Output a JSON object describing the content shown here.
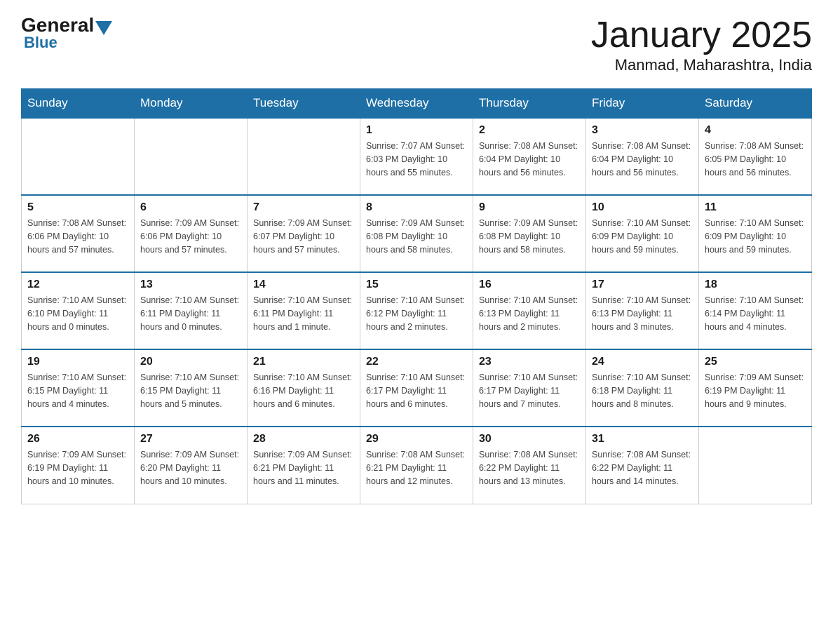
{
  "header": {
    "logo": {
      "general": "General",
      "blue": "Blue"
    },
    "title": "January 2025",
    "location": "Manmad, Maharashtra, India"
  },
  "days": [
    "Sunday",
    "Monday",
    "Tuesday",
    "Wednesday",
    "Thursday",
    "Friday",
    "Saturday"
  ],
  "weeks": [
    [
      {
        "day": "",
        "info": ""
      },
      {
        "day": "",
        "info": ""
      },
      {
        "day": "",
        "info": ""
      },
      {
        "day": "1",
        "info": "Sunrise: 7:07 AM\nSunset: 6:03 PM\nDaylight: 10 hours\nand 55 minutes."
      },
      {
        "day": "2",
        "info": "Sunrise: 7:08 AM\nSunset: 6:04 PM\nDaylight: 10 hours\nand 56 minutes."
      },
      {
        "day": "3",
        "info": "Sunrise: 7:08 AM\nSunset: 6:04 PM\nDaylight: 10 hours\nand 56 minutes."
      },
      {
        "day": "4",
        "info": "Sunrise: 7:08 AM\nSunset: 6:05 PM\nDaylight: 10 hours\nand 56 minutes."
      }
    ],
    [
      {
        "day": "5",
        "info": "Sunrise: 7:08 AM\nSunset: 6:06 PM\nDaylight: 10 hours\nand 57 minutes."
      },
      {
        "day": "6",
        "info": "Sunrise: 7:09 AM\nSunset: 6:06 PM\nDaylight: 10 hours\nand 57 minutes."
      },
      {
        "day": "7",
        "info": "Sunrise: 7:09 AM\nSunset: 6:07 PM\nDaylight: 10 hours\nand 57 minutes."
      },
      {
        "day": "8",
        "info": "Sunrise: 7:09 AM\nSunset: 6:08 PM\nDaylight: 10 hours\nand 58 minutes."
      },
      {
        "day": "9",
        "info": "Sunrise: 7:09 AM\nSunset: 6:08 PM\nDaylight: 10 hours\nand 58 minutes."
      },
      {
        "day": "10",
        "info": "Sunrise: 7:10 AM\nSunset: 6:09 PM\nDaylight: 10 hours\nand 59 minutes."
      },
      {
        "day": "11",
        "info": "Sunrise: 7:10 AM\nSunset: 6:09 PM\nDaylight: 10 hours\nand 59 minutes."
      }
    ],
    [
      {
        "day": "12",
        "info": "Sunrise: 7:10 AM\nSunset: 6:10 PM\nDaylight: 11 hours\nand 0 minutes."
      },
      {
        "day": "13",
        "info": "Sunrise: 7:10 AM\nSunset: 6:11 PM\nDaylight: 11 hours\nand 0 minutes."
      },
      {
        "day": "14",
        "info": "Sunrise: 7:10 AM\nSunset: 6:11 PM\nDaylight: 11 hours\nand 1 minute."
      },
      {
        "day": "15",
        "info": "Sunrise: 7:10 AM\nSunset: 6:12 PM\nDaylight: 11 hours\nand 2 minutes."
      },
      {
        "day": "16",
        "info": "Sunrise: 7:10 AM\nSunset: 6:13 PM\nDaylight: 11 hours\nand 2 minutes."
      },
      {
        "day": "17",
        "info": "Sunrise: 7:10 AM\nSunset: 6:13 PM\nDaylight: 11 hours\nand 3 minutes."
      },
      {
        "day": "18",
        "info": "Sunrise: 7:10 AM\nSunset: 6:14 PM\nDaylight: 11 hours\nand 4 minutes."
      }
    ],
    [
      {
        "day": "19",
        "info": "Sunrise: 7:10 AM\nSunset: 6:15 PM\nDaylight: 11 hours\nand 4 minutes."
      },
      {
        "day": "20",
        "info": "Sunrise: 7:10 AM\nSunset: 6:15 PM\nDaylight: 11 hours\nand 5 minutes."
      },
      {
        "day": "21",
        "info": "Sunrise: 7:10 AM\nSunset: 6:16 PM\nDaylight: 11 hours\nand 6 minutes."
      },
      {
        "day": "22",
        "info": "Sunrise: 7:10 AM\nSunset: 6:17 PM\nDaylight: 11 hours\nand 6 minutes."
      },
      {
        "day": "23",
        "info": "Sunrise: 7:10 AM\nSunset: 6:17 PM\nDaylight: 11 hours\nand 7 minutes."
      },
      {
        "day": "24",
        "info": "Sunrise: 7:10 AM\nSunset: 6:18 PM\nDaylight: 11 hours\nand 8 minutes."
      },
      {
        "day": "25",
        "info": "Sunrise: 7:09 AM\nSunset: 6:19 PM\nDaylight: 11 hours\nand 9 minutes."
      }
    ],
    [
      {
        "day": "26",
        "info": "Sunrise: 7:09 AM\nSunset: 6:19 PM\nDaylight: 11 hours\nand 10 minutes."
      },
      {
        "day": "27",
        "info": "Sunrise: 7:09 AM\nSunset: 6:20 PM\nDaylight: 11 hours\nand 10 minutes."
      },
      {
        "day": "28",
        "info": "Sunrise: 7:09 AM\nSunset: 6:21 PM\nDaylight: 11 hours\nand 11 minutes."
      },
      {
        "day": "29",
        "info": "Sunrise: 7:08 AM\nSunset: 6:21 PM\nDaylight: 11 hours\nand 12 minutes."
      },
      {
        "day": "30",
        "info": "Sunrise: 7:08 AM\nSunset: 6:22 PM\nDaylight: 11 hours\nand 13 minutes."
      },
      {
        "day": "31",
        "info": "Sunrise: 7:08 AM\nSunset: 6:22 PM\nDaylight: 11 hours\nand 14 minutes."
      },
      {
        "day": "",
        "info": ""
      }
    ]
  ]
}
